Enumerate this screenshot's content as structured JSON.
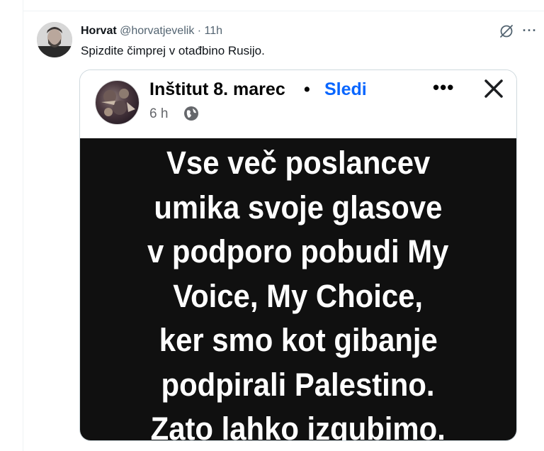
{
  "tweet": {
    "author_name": "Horvat",
    "author_handle": "@horvatjevelik",
    "separator": "·",
    "timestamp": "11h",
    "text": "Spizdite čimprej v otađbino Rusijo."
  },
  "embedded_post": {
    "page_name": "Inštitut 8. marec",
    "separator": "•",
    "follow_label": "Sledi",
    "time": "6 h",
    "more_label": "•••",
    "quote_lines": [
      "Vse več poslancev",
      "umika svoje glasove",
      "v podporo pobudi My",
      "Voice, My Choice,",
      "ker smo kot gibanje",
      "podpirali Palestino.",
      "Zato lahko izgubimo."
    ]
  },
  "colors": {
    "follow_blue": "#0866ff",
    "muted_text": "#536471",
    "quote_background": "#101010"
  },
  "icons": [
    "grok-icon",
    "more-icon",
    "globe-icon",
    "close-icon"
  ]
}
